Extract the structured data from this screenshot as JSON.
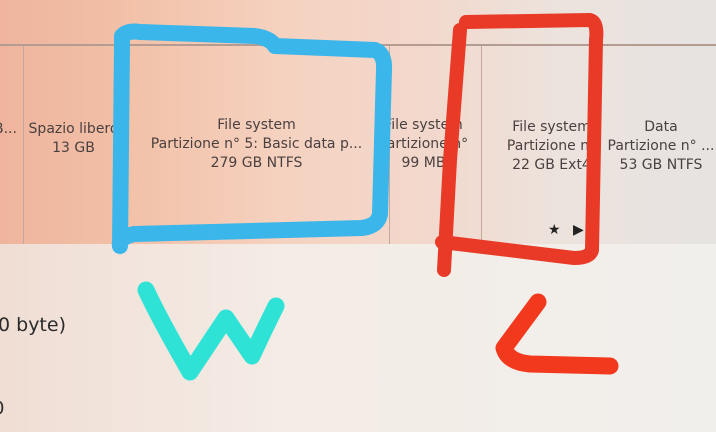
{
  "partitions": [
    {
      "line1": "B...",
      "line2": "",
      "line3": ""
    },
    {
      "line1": "Spazio libero",
      "line2": "13 GB",
      "line3": ""
    },
    {
      "line1": "File system",
      "line2": "Partizione n° 5: Basic data p...",
      "line3": "279 GB NTFS"
    },
    {
      "line1": "File system",
      "line2": "Partizione n°",
      "line3": "99 MB"
    },
    {
      "line1": "File system",
      "line2": "Partizione n°",
      "line3": "22 GB Ext4"
    },
    {
      "line1": "Data",
      "line2": "Partizione n° ...",
      "line3": "53 GB NTFS"
    }
  ],
  "size_label": "0 byte)",
  "bottom_value": "0",
  "marker_icons": "★ ▶",
  "annotations": {
    "blue_letter": "W",
    "red_letter": "L",
    "colors": {
      "blue": "#3ab6ea",
      "red": "#e83a26",
      "cyan": "#2ee3d6",
      "orange_red": "#f2391e"
    }
  }
}
